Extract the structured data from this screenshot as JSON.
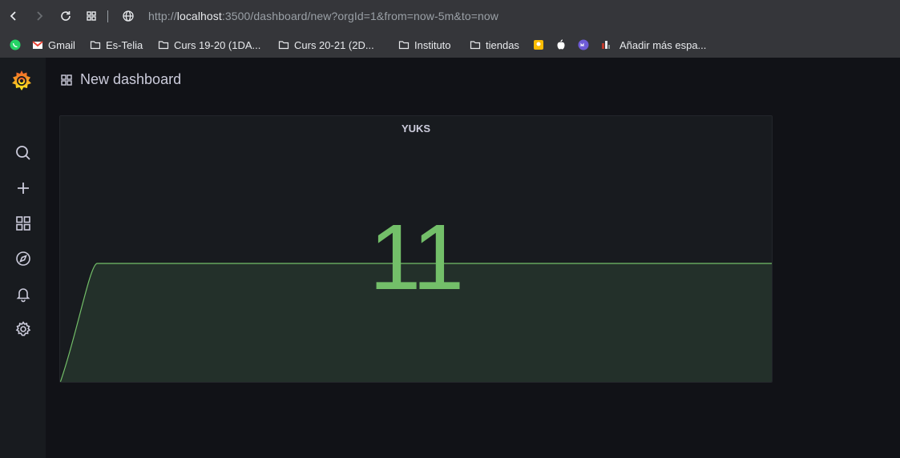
{
  "browser": {
    "url_scheme": "http://",
    "url_host": "localhost",
    "url_rest": ":3500/dashboard/new?orgId=1&from=now-5m&to=now",
    "bookmarks": [
      {
        "label": "",
        "icon": "whatsapp-icon"
      },
      {
        "label": "Gmail",
        "icon": "gmail-icon"
      },
      {
        "label": "Es-Telia",
        "icon": "folder-icon"
      },
      {
        "label": "Curs 19-20 (1DA...",
        "icon": "folder-icon"
      },
      {
        "label": "Curs 20-21 (2D...",
        "icon": "folder-icon"
      },
      {
        "label": "Instituto",
        "icon": "folder-icon"
      },
      {
        "label": "tiendas",
        "icon": "folder-icon"
      },
      {
        "label": "",
        "icon": "keep-icon"
      },
      {
        "label": "",
        "icon": "apple-icon"
      },
      {
        "label": "",
        "icon": "my-icon"
      },
      {
        "label": "",
        "icon": "app-icon"
      },
      {
        "label": "Añadir más espa...",
        "icon": ""
      }
    ]
  },
  "dashboard": {
    "title": "New dashboard"
  },
  "panel": {
    "title": "YUKS",
    "value": "11"
  },
  "colors": {
    "stat_green": "#73bf69",
    "sidebar_bg": "#181b1f",
    "app_bg": "#111217"
  },
  "chart_data": {
    "type": "area",
    "series": [
      {
        "values": [
          0,
          11,
          11,
          11,
          11,
          11,
          11,
          11,
          11,
          11,
          11,
          11,
          11,
          11,
          11,
          11,
          11,
          11,
          11,
          11
        ]
      }
    ],
    "ylim": [
      0,
      11
    ]
  }
}
